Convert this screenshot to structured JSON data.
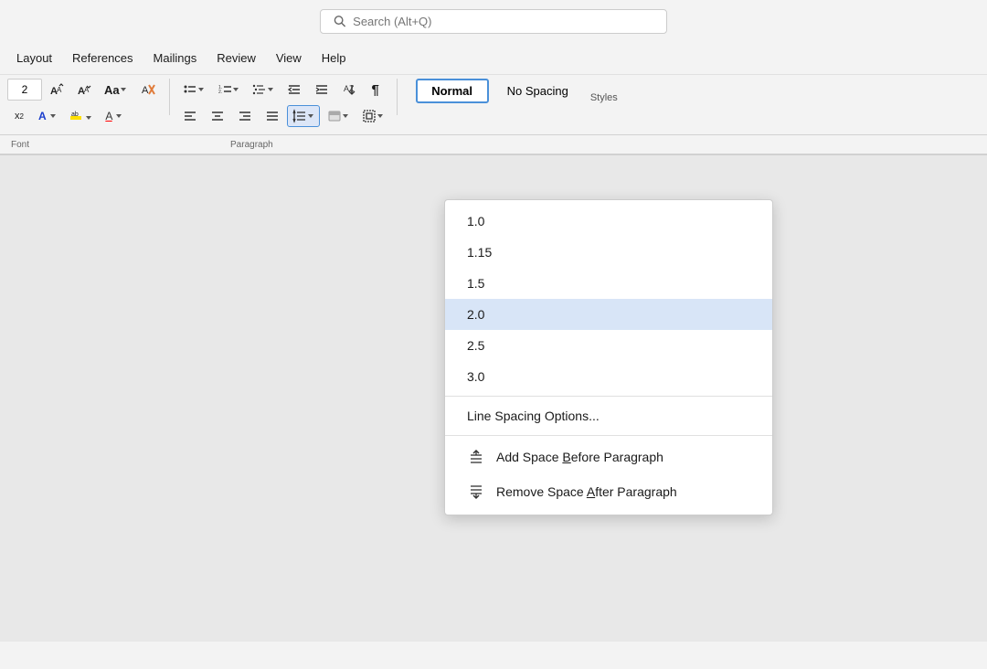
{
  "titlebar": {
    "search_placeholder": "Search (Alt+Q)"
  },
  "menubar": {
    "items": [
      "Layout",
      "References",
      "Mailings",
      "Review",
      "View",
      "Help"
    ]
  },
  "ribbon": {
    "font_size": "2",
    "section_labels": [
      "Font",
      "",
      "Paragraph",
      "",
      "",
      "Styles"
    ],
    "styles": {
      "normal_label": "Normal",
      "no_spacing_label": "No Spacing",
      "styles_label": "Styles"
    }
  },
  "dropdown": {
    "spacing_options": [
      {
        "value": "1.0",
        "id": "spacing-1-0"
      },
      {
        "value": "1.15",
        "id": "spacing-1-15"
      },
      {
        "value": "1.5",
        "id": "spacing-1-5"
      },
      {
        "value": "2.0",
        "id": "spacing-2-0",
        "highlighted": true
      },
      {
        "value": "2.5",
        "id": "spacing-2-5"
      },
      {
        "value": "3.0",
        "id": "spacing-3-0"
      }
    ],
    "line_spacing_options_label": "Line Spacing Options...",
    "add_space_label": "Add Space ",
    "add_space_b_label": "B",
    "add_space_rest": "efore Paragraph",
    "remove_space_label": "Remove Space ",
    "remove_space_a_label": "A",
    "remove_space_rest": "fter Paragraph"
  }
}
